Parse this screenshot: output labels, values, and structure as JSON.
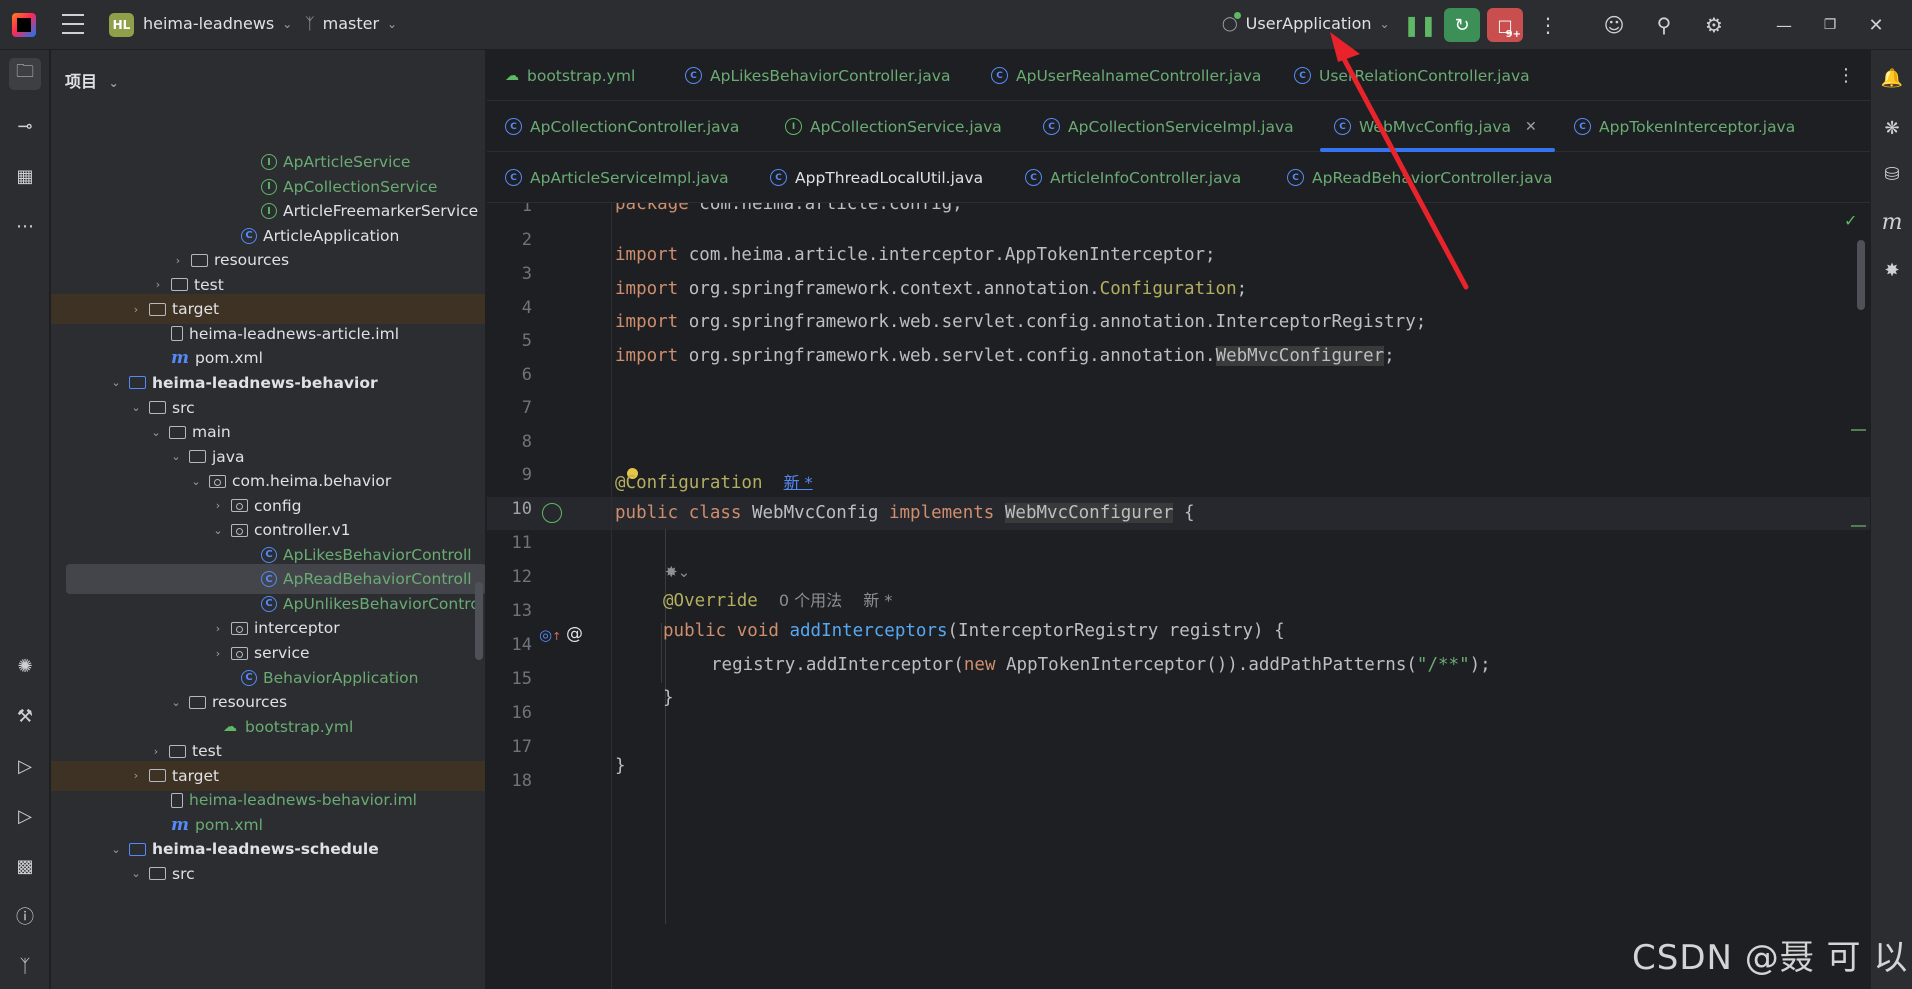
{
  "topbar": {
    "project_badge": "HL",
    "project_name": "heima-leadnews",
    "branch": "master",
    "run_config": "UserApplication",
    "debug_badge": "9+"
  },
  "project_panel": {
    "title": "项目",
    "rows": [
      {
        "label": "ApArticleService",
        "kind": "iface"
      },
      {
        "label": "ApCollectionService",
        "kind": "iface"
      },
      {
        "label": "ArticleFreemarkerService",
        "kind": "iface"
      },
      {
        "label": "ArticleApplication",
        "kind": "app"
      },
      {
        "label": "resources",
        "kind": "folder"
      },
      {
        "label": "test",
        "kind": "folder"
      },
      {
        "label": "target",
        "kind": "folder"
      },
      {
        "label": "heima-leadnews-article.iml",
        "kind": "file"
      },
      {
        "label": "pom.xml",
        "kind": "maven"
      },
      {
        "label": "heima-leadnews-behavior",
        "kind": "module"
      },
      {
        "label": "src",
        "kind": "folder"
      },
      {
        "label": "main",
        "kind": "folder"
      },
      {
        "label": "java",
        "kind": "folder"
      },
      {
        "label": "com.heima.behavior",
        "kind": "package"
      },
      {
        "label": "config",
        "kind": "package"
      },
      {
        "label": "controller.v1",
        "kind": "package"
      },
      {
        "label": "ApLikesBehaviorControll",
        "kind": "class"
      },
      {
        "label": "ApReadBehaviorControll",
        "kind": "class"
      },
      {
        "label": "ApUnlikesBehaviorContro",
        "kind": "class"
      },
      {
        "label": "interceptor",
        "kind": "package"
      },
      {
        "label": "service",
        "kind": "package"
      },
      {
        "label": "BehaviorApplication",
        "kind": "app"
      },
      {
        "label": "resources",
        "kind": "folder"
      },
      {
        "label": "bootstrap.yml",
        "kind": "yml"
      },
      {
        "label": "test",
        "kind": "folder"
      },
      {
        "label": "target",
        "kind": "folder"
      },
      {
        "label": "heima-leadnews-behavior.iml",
        "kind": "file"
      },
      {
        "label": "pom.xml",
        "kind": "maven"
      },
      {
        "label": "heima-leadnews-schedule",
        "kind": "module"
      },
      {
        "label": "src",
        "kind": "folder"
      }
    ]
  },
  "tabs": {
    "row1": [
      "bootstrap.yml",
      "ApLikesBehaviorController.java",
      "ApUserRealnameController.java",
      "UserRelationController.java"
    ],
    "row2": [
      "ApCollectionController.java",
      "ApCollectionService.java",
      "ApCollectionServiceImpl.java",
      "WebMvcConfig.java",
      "AppTokenInterceptor.java"
    ],
    "row3": [
      "ApArticleServiceImpl.java",
      "AppThreadLocalUtil.java",
      "ArticleInfoController.java",
      "ApReadBehaviorController.java"
    ]
  },
  "editor": {
    "line_numbers": [
      "1",
      "2",
      "3",
      "4",
      "5",
      "6",
      "7",
      "8",
      "9",
      "10",
      "11",
      "12",
      "13",
      "14",
      "15",
      "16",
      "17",
      "18"
    ],
    "l1_kw": "package",
    "l1_rest": " com.heima.article.config;",
    "l4_kw": "import",
    "l4_rest": " com.heima.article.interceptor.AppTokenInterceptor;",
    "l5_kw": "import",
    "l5_a": " org.springframework.context.annotation.",
    "l5_b": "Configuration",
    "l5_c": ";",
    "l6_kw": "import",
    "l6_rest": " org.springframework.web.servlet.config.annotation.InterceptorRegistry;",
    "l7_kw": "import",
    "l7_a": " org.springframework.web.servlet.config.annotation.",
    "l7_b": "WebMvcConfigurer",
    "l7_c": ";",
    "l9_ann": "@Configuration",
    "l9_hint": "新 *",
    "l10_kw1": "public",
    "l10_kw2": "class",
    "l10_name": " WebMvcConfig ",
    "l10_kw3": "implements",
    "l10_iface": "WebMvcConfigurer",
    "l10_end": " {",
    "l12_ann": "@Override",
    "l12_hint1": "0 个用法",
    "l12_hint2": "新 *",
    "l13_kw1": "public",
    "l13_kw2": "void",
    "l13_fn": "addInterceptors",
    "l13_rest": "(InterceptorRegistry registry) {",
    "l14_a": "registry.addInterceptor(",
    "l14_kw": "new",
    "l14_b": " AppTokenInterceptor()).addPathPatterns(",
    "l14_str": "\"/**\"",
    "l14_c": ");",
    "l15": "}",
    "l17": "}"
  },
  "watermark": "CSDN @聂 可 以",
  "colors": {
    "keyword": "#cf8e6d",
    "annotation": "#b3ae60",
    "function": "#56a8f5",
    "string": "#6aab73",
    "accent": "#3574f0",
    "arrow": "#e8232b"
  }
}
